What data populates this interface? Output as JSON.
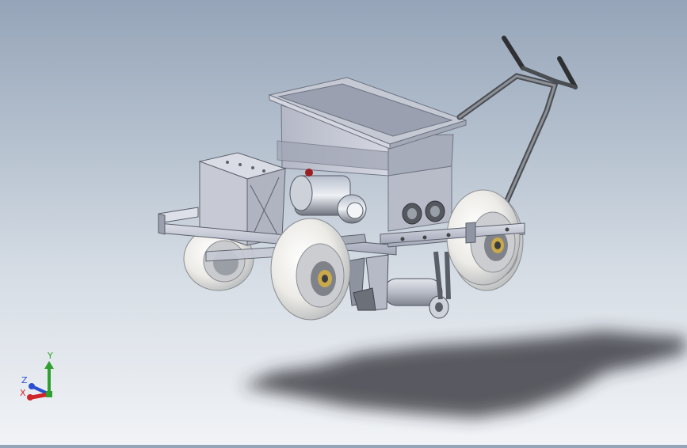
{
  "viewport": {
    "model": "seeding-machine-assembly",
    "view": "isometric-shaded"
  },
  "triad": {
    "y_label": "Y",
    "z_label": "Z",
    "x_label": "X",
    "colors": {
      "x": "#d0262b",
      "y": "#2fa02f",
      "z": "#2a4fd0"
    }
  }
}
